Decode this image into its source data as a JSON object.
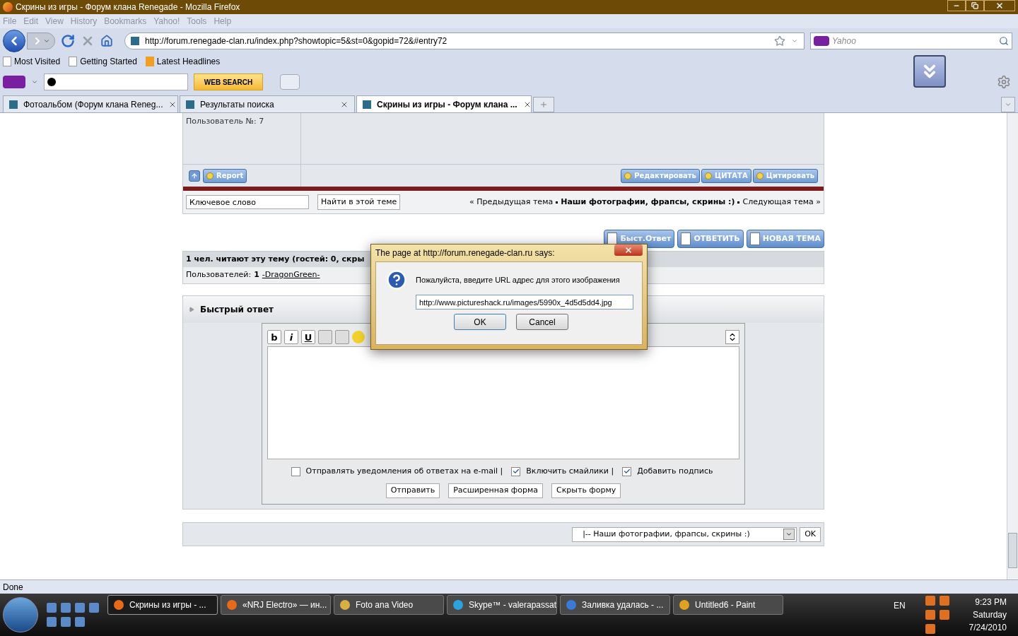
{
  "window": {
    "title": "Скрины из игры - Форум клана Renegade - Mozilla Firefox"
  },
  "menu": [
    "File",
    "Edit",
    "View",
    "History",
    "Bookmarks",
    "Yahoo!",
    "Tools",
    "Help"
  ],
  "address": {
    "url": "http://forum.renegade-clan.ru/index.php?showtopic=5&st=0&gopid=72&#entry72"
  },
  "search": {
    "placeholder": "Yahoo"
  },
  "bookmarks": [
    "Most Visited",
    "Getting Started",
    "Latest Headlines"
  ],
  "yahoo_toolbar": {
    "button": "WEB SEARCH"
  },
  "tabs": [
    {
      "label": "Фотоальбом (Форум клана Reneg...",
      "selected": false
    },
    {
      "label": "Результаты поиска",
      "selected": false
    },
    {
      "label": "Скрины из игры - Форум клана ...",
      "selected": true
    }
  ],
  "post": {
    "author_info": "Пользователь №: 7",
    "left_buttons": [
      "Report"
    ],
    "right_buttons": [
      "Редактировать",
      "ЦИТАТА",
      "Цитировать"
    ]
  },
  "topic_nav": {
    "keyword": "Ключевое слово",
    "search_button": "Найти в этой теме",
    "prev": "« Предыдущая тема",
    "current": "Наши фотографии, фрапсы, скрины :)",
    "next": "Следующая тема »"
  },
  "actions": [
    "Быст.Ответ",
    "ОТВЕТИТЬ",
    "НОВАЯ ТЕМА"
  ],
  "readers": {
    "title": "1 чел. читают эту тему (гостей: 0, скры",
    "label": "Пользователей:",
    "count": "1",
    "user": "-DragonGreen-"
  },
  "quick_reply": {
    "title": "Быстрый ответ",
    "format_buttons": [
      {
        "label": "b",
        "kind": "bold"
      },
      {
        "label": "i",
        "kind": "italic"
      },
      {
        "label": "U",
        "kind": "underline"
      }
    ],
    "options": [
      {
        "label": "Отправлять уведомления об ответах на e-mail |",
        "checked": false
      },
      {
        "label": "Включить смайлики |",
        "checked": true
      },
      {
        "label": "Добавить подпись",
        "checked": true
      }
    ],
    "buttons": [
      "Отправить",
      "Расширенная форма",
      "Скрыть форму"
    ]
  },
  "jump": {
    "value": "|-- Наши фотографии, фрапсы, скрины :)",
    "button": "OK"
  },
  "status_bar": "Done",
  "dialog": {
    "title": "The page at http://forum.renegade-clan.ru says:",
    "message": "Пожалуйста, введите URL адрес для этого изображения",
    "value": "http://www.pictureshack.ru/images/5990x_4d5d5dd4.jpg",
    "buttons": [
      "OK",
      "Cancel"
    ]
  },
  "taskbar": [
    {
      "label": "Скрины из игры - ...",
      "selected": true,
      "color": "#e66a1a"
    },
    {
      "label": "«NRJ Electro» — ин...",
      "selected": false,
      "color": "#e66a1a"
    },
    {
      "label": "Foto ana Video",
      "selected": false,
      "color": "#d8b040"
    },
    {
      "label": "Skype™ - valerapassat",
      "selected": false,
      "color": "#2aa4e0"
    },
    {
      "label": "Заливка удалась - ...",
      "selected": false,
      "color": "#3a7ad8"
    },
    {
      "label": "Untitled6 - Paint",
      "selected": false,
      "color": "#e0a020"
    }
  ],
  "tray": {
    "language": "EN",
    "time": "9:23 PM",
    "day": "Saturday",
    "date": "7/24/2010"
  }
}
